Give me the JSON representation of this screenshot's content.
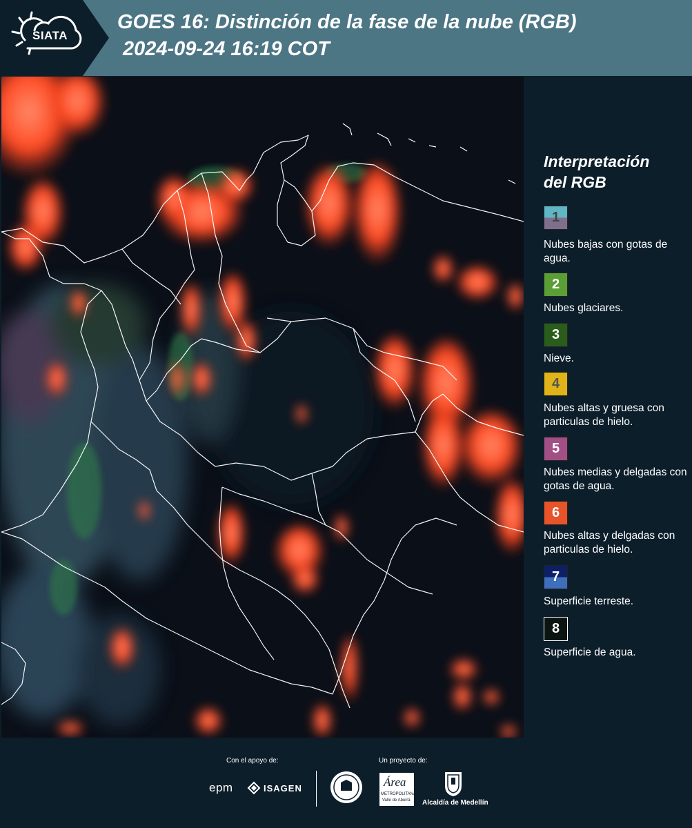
{
  "header": {
    "logo_text": "SIATA",
    "title_line1": "GOES 16: Distinción de la fase de la nube (RGB)",
    "title_line2": "2024-09-24 16:19 COT"
  },
  "legend": {
    "title_line1": "Interpretación",
    "title_line2": "del RGB",
    "items": [
      {
        "number": "1",
        "label": "Nubes bajas con gotas de agua.",
        "color_top": "#5fb6c4",
        "color_bottom": "#7e6f8d",
        "text_color": "#444444"
      },
      {
        "number": "2",
        "label": "Nubes glaciares.",
        "color_top": "#5a9e35",
        "color_bottom": "#5a9e35",
        "text_color": "#ffffff"
      },
      {
        "number": "3",
        "label": "Nieve.",
        "color_top": "#2a5d1c",
        "color_bottom": "#2a5d1c",
        "text_color": "#ffffff"
      },
      {
        "number": "4",
        "label": "Nubes altas y gruesa con particulas de hielo.",
        "color_top": "#e0b318",
        "color_bottom": "#e0b318",
        "text_color": "#555555"
      },
      {
        "number": "5",
        "label": "Nubes medias y delgadas con gotas de agua.",
        "color_top": "#a24f86",
        "color_bottom": "#a24f86",
        "text_color": "#ffffff"
      },
      {
        "number": "6",
        "label": "Nubes altas y delgadas con particulas de hielo.",
        "color_top": "#e8542a",
        "color_bottom": "#e8542a",
        "text_color": "#ffffff"
      },
      {
        "number": "7",
        "label": "Superficie terreste.",
        "color_top": "#0f1f66",
        "color_bottom": "#3e6fbd",
        "text_color": "#ffffff"
      },
      {
        "number": "8",
        "label": "Superficie de agua.",
        "color_top": "#0b1410",
        "color_bottom": "#0b1410",
        "text_color": "#ffffff"
      }
    ]
  },
  "footer": {
    "support_label": "Con el apoyo de:",
    "project_label": "Un proyecto de:",
    "sponsor_epm": "epm",
    "sponsor_isagen": "ISAGEN",
    "area_text": "Área",
    "area_subtitle": "METROPOLITANA",
    "area_subtitle2": "Valle de Aburrá",
    "alcaldia": "Alcaldía de Medellín"
  }
}
